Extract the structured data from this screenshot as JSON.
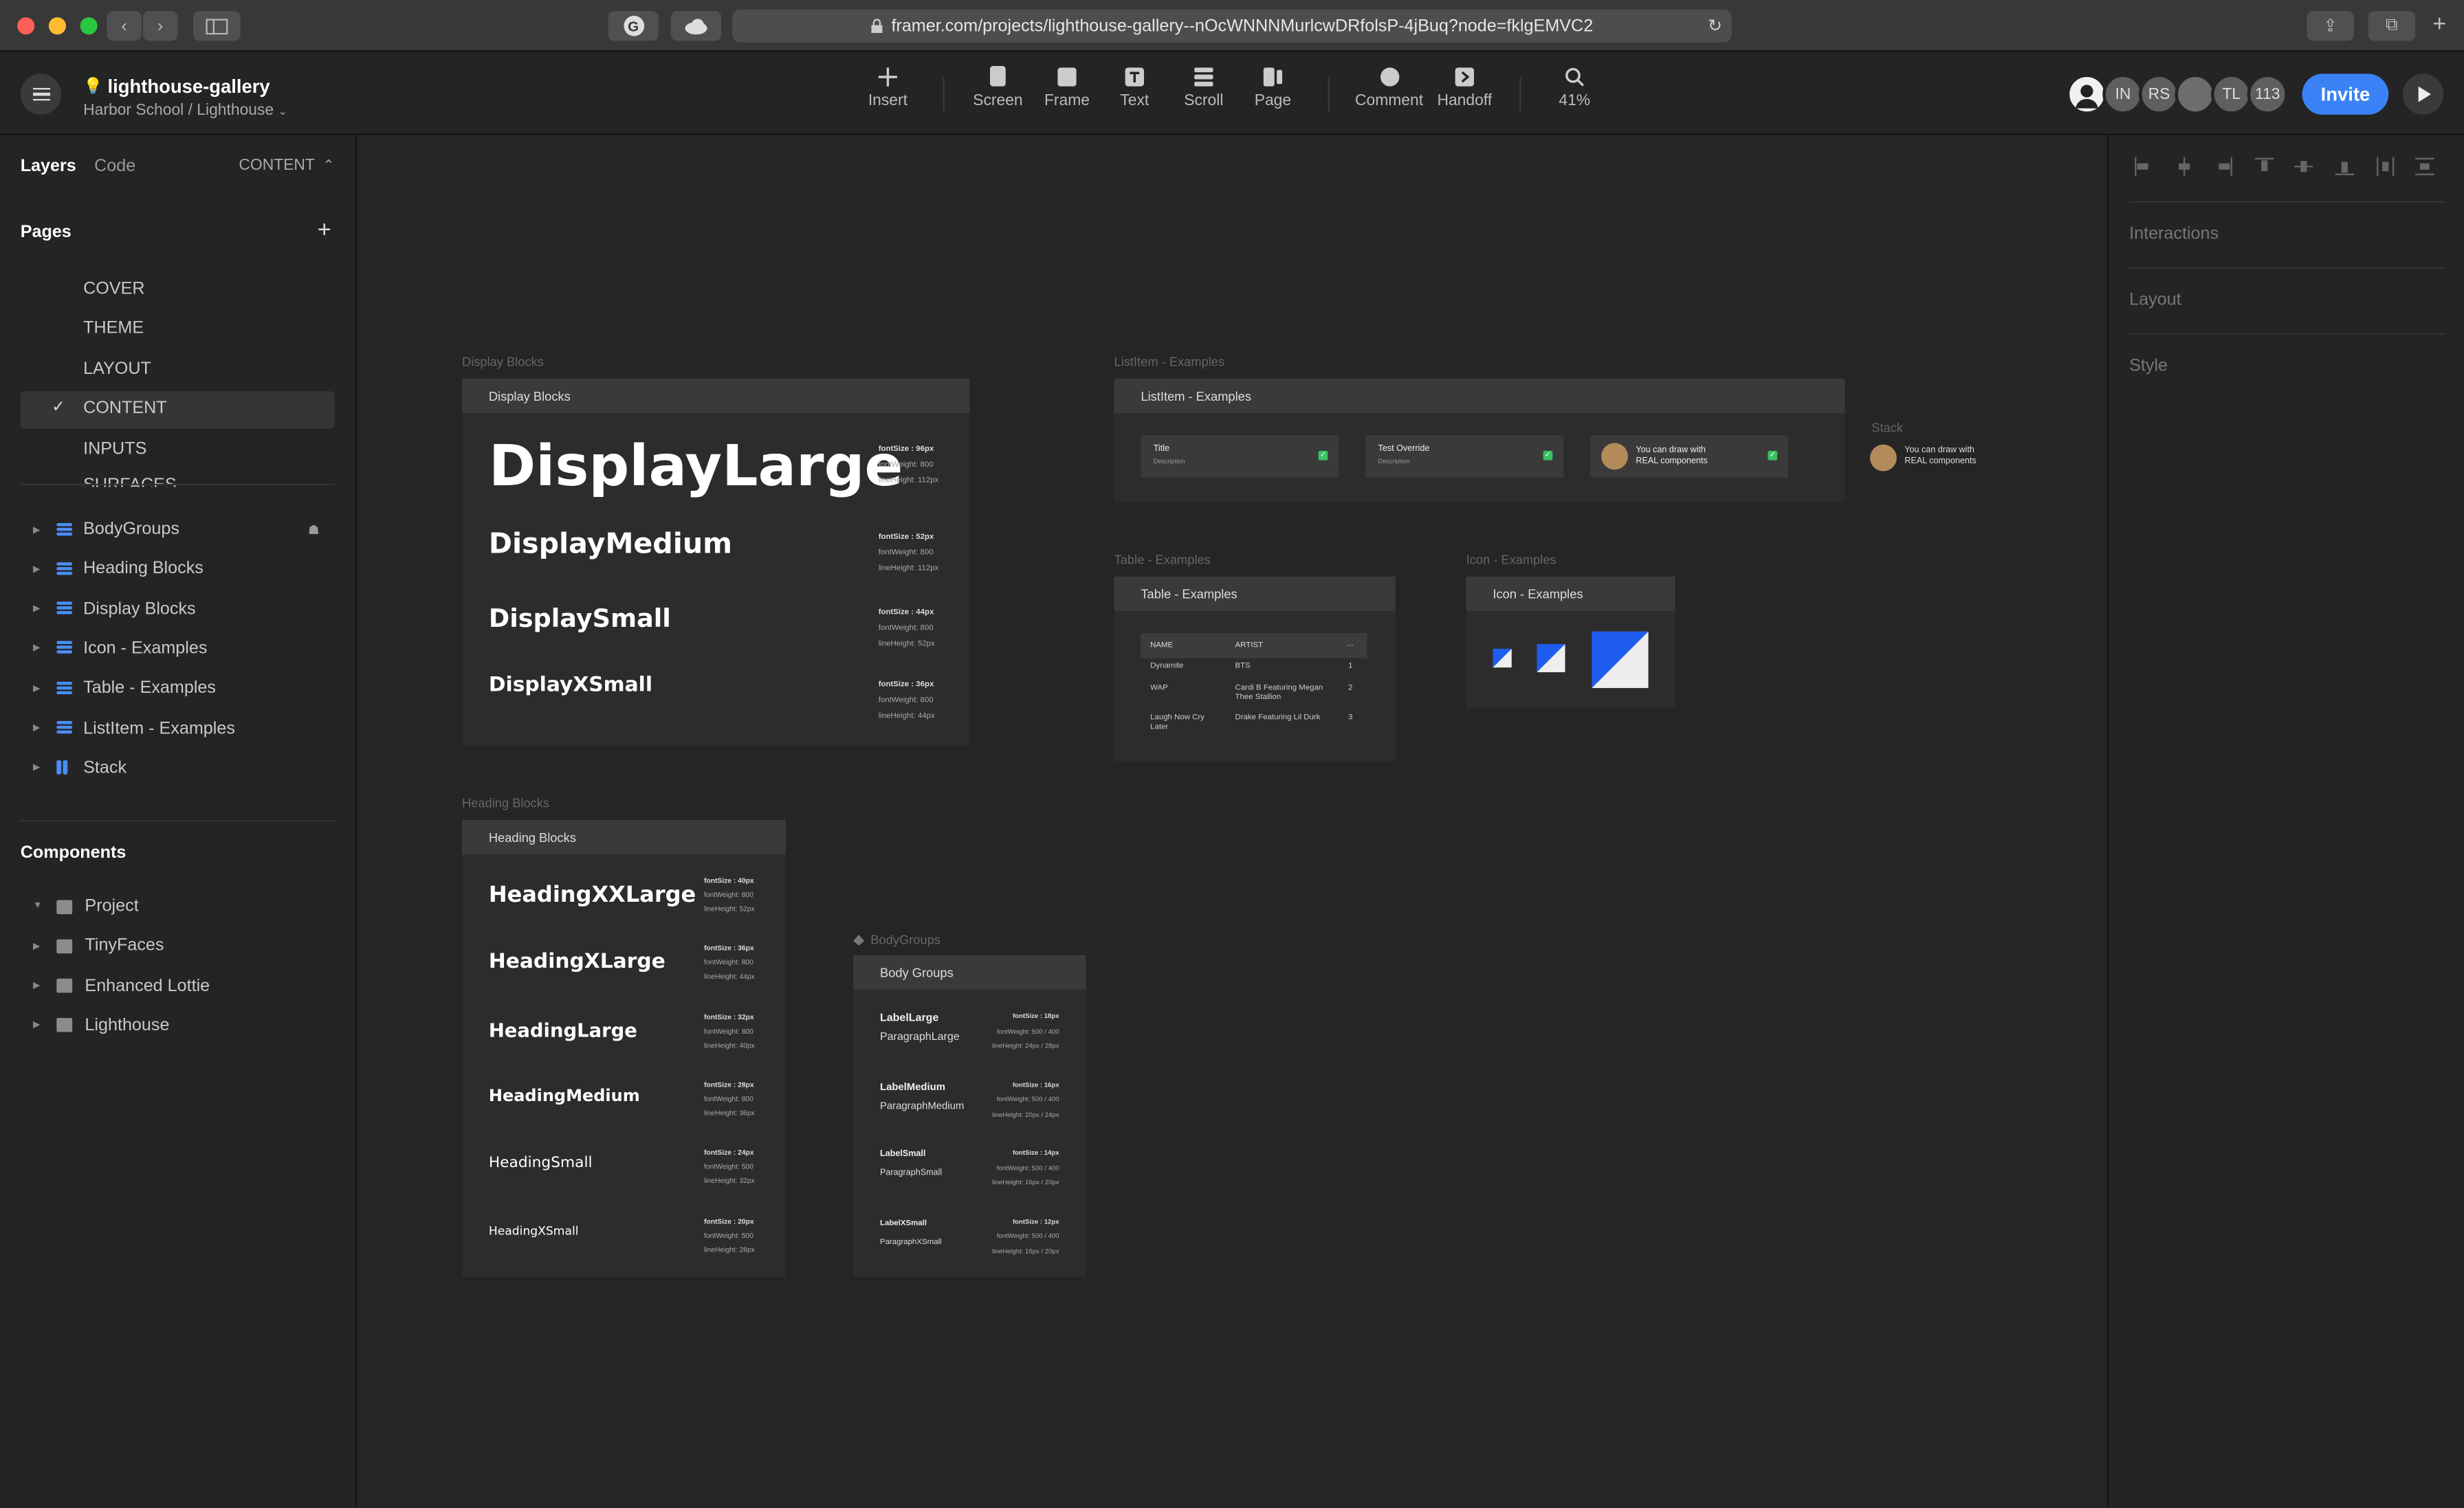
{
  "browser": {
    "url": "framer.com/projects/lighthouse-gallery--nOcWNNNMurlcwDRfolsP-4jBuq?node=fklgEMVC2"
  },
  "project": {
    "title": "lighthouse-gallery",
    "breadcrumb": "Harbor School / Lighthouse"
  },
  "toolbar": {
    "insert": "Insert",
    "screen": "Screen",
    "frame": "Frame",
    "text": "Text",
    "scroll": "Scroll",
    "page": "Page",
    "comment": "Comment",
    "handoff": "Handoff",
    "zoom": "41%"
  },
  "collaborators": [
    "IN",
    "RS",
    "TL",
    "113"
  ],
  "invite_label": "Invite",
  "left_panel": {
    "tabs": {
      "layers": "Layers",
      "code": "Code",
      "current": "CONTENT"
    },
    "pages_title": "Pages",
    "pages": [
      "COVER",
      "THEME",
      "LAYOUT",
      "CONTENT",
      "INPUTS",
      "SURFACES"
    ],
    "layers": [
      "BodyGroups",
      "Heading Blocks",
      "Display Blocks",
      "Icon - Examples",
      "Table - Examples",
      "ListItem - Examples",
      "Stack"
    ],
    "components_title": "Components",
    "components": [
      "Project",
      "TinyFaces",
      "Enhanced Lottie",
      "Lighthouse"
    ]
  },
  "right_panel": {
    "sections": [
      "Interactions",
      "Layout",
      "Style"
    ]
  },
  "canvas": {
    "display": {
      "label": "Display Blocks",
      "header": "Display Blocks",
      "items": [
        {
          "name": "DisplayLarge",
          "meta": [
            "fontSize : 96px",
            "fontWeight: 800",
            "lineHeight: 112px"
          ]
        },
        {
          "name": "DisplayMedium",
          "meta": [
            "fontSize : 52px",
            "fontWeight: 800",
            "lineHeight: 112px"
          ]
        },
        {
          "name": "DisplaySmall",
          "meta": [
            "fontSize : 44px",
            "fontWeight: 800",
            "lineHeight: 52px"
          ]
        },
        {
          "name": "DisplayXSmall",
          "meta": [
            "fontSize : 36px",
            "fontWeight: 800",
            "lineHeight: 44px"
          ]
        }
      ]
    },
    "heading": {
      "label": "Heading Blocks",
      "header": "Heading Blocks",
      "items": [
        {
          "name": "HeadingXXLarge",
          "meta": [
            "fontSize : 40px",
            "fontWeight: 800",
            "lineHeight: 52px"
          ]
        },
        {
          "name": "HeadingXLarge",
          "meta": [
            "fontSize : 36px",
            "fontWeight: 800",
            "lineHeight: 44px"
          ]
        },
        {
          "name": "HeadingLarge",
          "meta": [
            "fontSize : 32px",
            "fontWeight: 800",
            "lineHeight: 40px"
          ]
        },
        {
          "name": "HeadingMedium",
          "meta": [
            "fontSize : 28px",
            "fontWeight: 800",
            "lineHeight: 36px"
          ]
        },
        {
          "name": "HeadingSmall",
          "meta": [
            "fontSize : 24px",
            "fontWeight: 500",
            "lineHeight: 32px"
          ]
        },
        {
          "name": "HeadingXSmall",
          "meta": [
            "fontSize : 20px",
            "fontWeight: 500",
            "lineHeight: 28px"
          ]
        }
      ]
    },
    "body": {
      "label": "BodyGroups",
      "header": "Body Groups",
      "items": [
        {
          "label": "LabelLarge",
          "para": "ParagraphLarge",
          "meta": [
            "fontSize : 18px",
            "fontWeight: 500 / 400",
            "lineHeight: 24px / 28px"
          ]
        },
        {
          "label": "LabelMedium",
          "para": "ParagraphMedium",
          "meta": [
            "fontSize : 16px",
            "fontWeight: 500 / 400",
            "lineHeight: 20px / 24px"
          ]
        },
        {
          "label": "LabelSmall",
          "para": "ParagraphSmall",
          "meta": [
            "fontSize : 14px",
            "fontWeight: 500 / 400",
            "lineHeight: 16px / 20px"
          ]
        },
        {
          "label": "LabelXSmall",
          "para": "ParagraphXSmall",
          "meta": [
            "fontSize : 12px",
            "fontWeight: 500 / 400",
            "lineHeight: 16px / 20px"
          ]
        }
      ]
    },
    "listitem": {
      "label": "ListItem - Examples",
      "header": "ListItem - Examples",
      "items": [
        {
          "title": "Title",
          "desc": "Description"
        },
        {
          "title": "Test Override",
          "desc": "Description"
        },
        {
          "title": "You can draw with",
          "desc": "REAL components"
        }
      ]
    },
    "stack": {
      "label": "Stack",
      "line1": "You can draw with",
      "line2": "REAL components"
    },
    "table": {
      "label": "Table - Examples",
      "header": "Table - Examples",
      "columns": [
        "NAME",
        "ARTIST",
        "..."
      ],
      "rows": [
        [
          "Dynamite",
          "BTS",
          "1"
        ],
        [
          "WAP",
          "Cardi B Featuring Megan Thee Stallion",
          "2"
        ],
        [
          "Laugh Now Cry Later",
          "Drake Featuring Lil Durk",
          "3"
        ]
      ]
    },
    "icon": {
      "label": "Icon - Examples",
      "header": "Icon - Examples"
    }
  },
  "colors": {
    "accent": "#3b82f6",
    "bg": "#242424",
    "canvas": "#252525",
    "frame": "#2c2c2c",
    "iconBlue": "#1f5cf0"
  }
}
